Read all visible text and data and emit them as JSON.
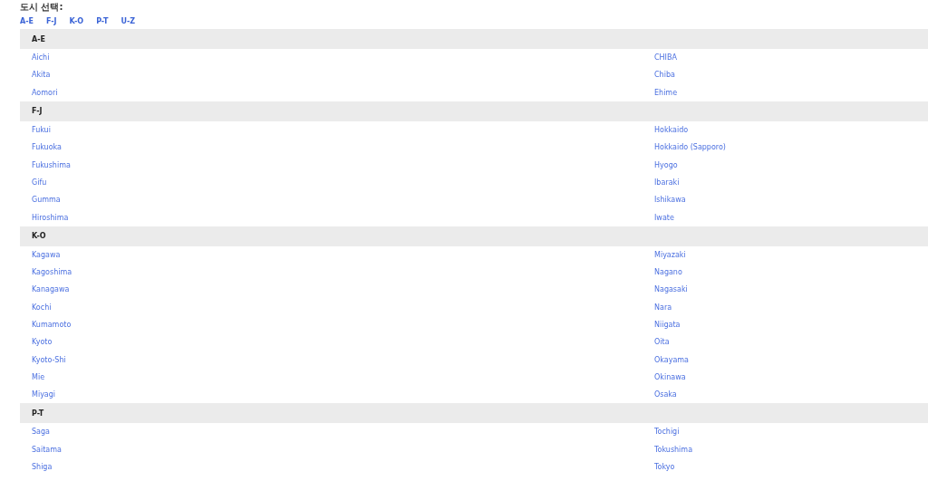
{
  "title": "도시 선택:",
  "nav_links": [
    "A-E",
    "F-J",
    "K-O",
    "P-T",
    "U-Z"
  ],
  "sections": [
    {
      "heading": "A-E",
      "left": [
        "Aichi",
        "Akita",
        "Aomori"
      ],
      "right": [
        "CHIBA",
        "Chiba",
        "Ehime"
      ]
    },
    {
      "heading": "F-J",
      "left": [
        "Fukui",
        "Fukuoka",
        "Fukushima",
        "Gifu",
        "Gumma",
        "Hiroshima"
      ],
      "right": [
        "Hokkaido",
        "Hokkaido (Sapporo)",
        "Hyogo",
        "Ibaraki",
        "Ishikawa",
        "Iwate"
      ]
    },
    {
      "heading": "K-O",
      "left": [
        "Kagawa",
        "Kagoshima",
        "Kanagawa",
        "Kochi",
        "Kumamoto",
        "Kyoto",
        "Kyoto-Shi",
        "Mie",
        "Miyagi"
      ],
      "right": [
        "Miyazaki",
        "Nagano",
        "Nagasaki",
        "Nara",
        "Niigata",
        "Oita",
        "Okayama",
        "Okinawa",
        "Osaka"
      ]
    },
    {
      "heading": "P-T",
      "left": [
        "Saga",
        "Saitama",
        "Shiga"
      ],
      "right": [
        "Tochigi",
        "Tokushima",
        "Tokyo"
      ]
    }
  ]
}
